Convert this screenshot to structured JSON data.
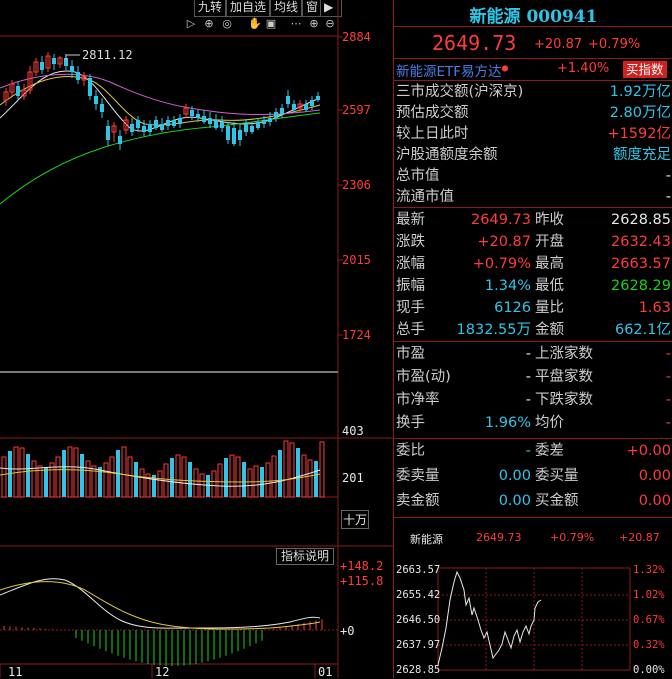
{
  "toolbar": {
    "items": [
      "九转",
      "加自选",
      "均线",
      "窗"
    ],
    "icons": [
      "play-icon",
      "plus-circle-icon",
      "eye-icon",
      "hand-icon",
      "layers-icon",
      "dots-icon",
      "plus-zoom-icon",
      "minus-zoom-icon"
    ]
  },
  "kline": {
    "y_ticks": [
      "2884",
      "2597",
      "2306",
      "2015",
      "1724"
    ],
    "high_marker": "2811.12"
  },
  "volume": {
    "y_ticks": [
      "403",
      "201"
    ],
    "unit": "十万"
  },
  "indicator": {
    "button": "指标说明",
    "y_ticks": [
      "+148.2",
      "+115.8",
      "+0"
    ]
  },
  "x_axis": [
    "11",
    "12",
    "01"
  ],
  "header": {
    "name": "新能源",
    "code": "000941",
    "price": "2649.73",
    "change": "+20.87",
    "change_pct": "+0.79%"
  },
  "etf": {
    "name": "新能源ETF易方达",
    "pct": "+1.40%",
    "button": "买指数"
  },
  "market": [
    {
      "label": "三市成交额(沪深京)",
      "value": "1.92万亿",
      "color": "cyan"
    },
    {
      "label": "预估成交额",
      "value": "2.80万亿",
      "color": "cyan"
    },
    {
      "label": "较上日此时",
      "value": "+1592亿",
      "color": "red"
    },
    {
      "label": "沪股通额度余额",
      "value": "额度充足",
      "color": "cyan"
    },
    {
      "label": "总市值",
      "value": "-",
      "color": "white"
    },
    {
      "label": "流通市值",
      "value": "-",
      "color": "white"
    }
  ],
  "quote": [
    {
      "l1": "最新",
      "v1": "2649.73",
      "c1": "red",
      "l2": "昨收",
      "v2": "2628.85",
      "c2": "white"
    },
    {
      "l1": "涨跌",
      "v1": "+20.87",
      "c1": "red",
      "l2": "开盘",
      "v2": "2632.43",
      "c2": "red"
    },
    {
      "l1": "涨幅",
      "v1": "+0.79%",
      "c1": "red",
      "l2": "最高",
      "v2": "2663.57",
      "c2": "red"
    },
    {
      "l1": "振幅",
      "v1": "1.34%",
      "c1": "cyan",
      "l2": "最低",
      "v2": "2628.29",
      "c2": "green"
    },
    {
      "l1": "现手",
      "v1": "6126",
      "c1": "cyan",
      "l2": "量比",
      "v2": "1.63",
      "c2": "red"
    },
    {
      "l1": "总手",
      "v1": "1832.55万",
      "c1": "cyan",
      "l2": "金额",
      "v2": "662.1亿",
      "c2": "cyan"
    }
  ],
  "pe": [
    {
      "l1": "市盈",
      "v1": "-",
      "l2": "上涨家数",
      "v2": "-"
    },
    {
      "l1": "市盈(动)",
      "v1": "-",
      "l2": "平盘家数",
      "v2": "-"
    },
    {
      "l1": "市净率",
      "v1": "-",
      "l2": "下跌家数",
      "v2": "-"
    },
    {
      "l1": "换手",
      "v1": "1.96%",
      "l2": "均价",
      "v2": "-"
    }
  ],
  "order": [
    {
      "l1": "委比",
      "v1": "-",
      "l2": "委差",
      "v2": "+0.00"
    },
    {
      "l1": "委卖量",
      "v1": "0.00",
      "l2": "委买量",
      "v2": "0.00"
    },
    {
      "l1": "卖金额",
      "v1": "0.00",
      "l2": "买金额",
      "v2": "0.00"
    }
  ],
  "mini": {
    "name": "新能源",
    "price": "2649.73",
    "pct": "+0.79%",
    "chg": "+20.87",
    "left_ticks": [
      "2663.57",
      "2655.42",
      "2646.50",
      "2637.97",
      "2628.85"
    ],
    "right_ticks": [
      "1.32%",
      "1.02%",
      "0.67%",
      "0.32%",
      "0.00%"
    ]
  },
  "colors": {
    "up": "#ff3b3b",
    "down": "#19d219",
    "cyan": "#2ec6e8",
    "border": "#8b1a1a"
  }
}
